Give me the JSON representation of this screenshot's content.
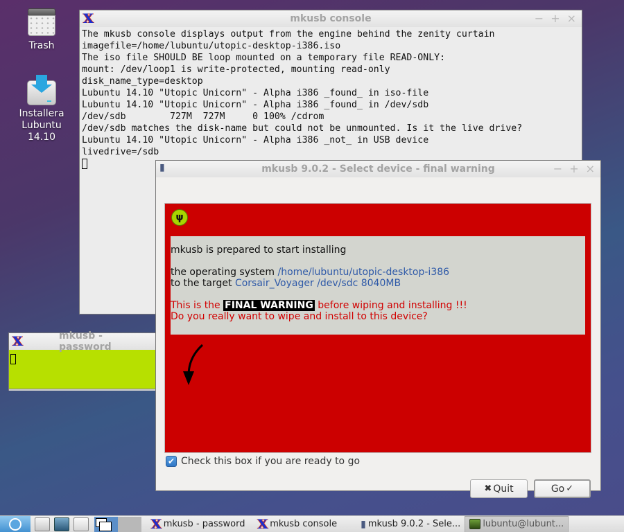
{
  "desktop": {
    "icons": [
      {
        "label": "Trash",
        "icon": "trash-icon"
      },
      {
        "label": "Installera\nLubuntu 14.10",
        "label_line1": "Installera",
        "label_line2": "Lubuntu 14.10",
        "icon": "install-drive-icon"
      }
    ],
    "background_colors": [
      "#5a2f6a",
      "#3a5886",
      "#4a4c8a"
    ]
  },
  "console": {
    "title": "mkusb console",
    "icon": "xterm-icon",
    "wm_buttons": {
      "minimize": "−",
      "maximize": "+",
      "close": "×"
    },
    "lines": [
      "The mkusb console displays output from the engine behind the zenity curtain",
      "imagefile=/home/lubuntu/utopic-desktop-i386.iso",
      "The iso file SHOULD BE loop mounted on a temporary file READ-ONLY:",
      "mount: /dev/loop1 is write-protected, mounting read-only",
      "disk_name_type=desktop",
      "Lubuntu 14.10 \"Utopic Unicorn\" - Alpha i386 _found_ in iso-file",
      "Lubuntu 14.10 \"Utopic Unicorn\" - Alpha i386 _found_ in /dev/sdb",
      "/dev/sdb        727M  727M     0 100% /cdrom",
      "/dev/sdb matches the disk-name but could not be unmounted. Is it the live drive?",
      "Lubuntu 14.10 \"Utopic Unicorn\" - Alpha i386 _not_ in USB device",
      "livedrive=/sdb"
    ]
  },
  "password_window": {
    "title": "mkusb - password",
    "icon": "xterm-icon",
    "background": "#b7e000"
  },
  "dialog": {
    "title": "mkusb 9.0.2 - Select device - final warning",
    "icon": "usb-drive-icon",
    "wm_buttons": {
      "minimize": "−",
      "maximize": "+",
      "close": "×"
    },
    "badge_icon": "usb-symbol-icon",
    "badge_glyph": "ψ",
    "message": {
      "line1": "mkusb is prepared to start installing",
      "os_prefix": "the operating system ",
      "os_value": "/home/lubuntu/utopic-desktop-i386",
      "target_prefix": "to the target ",
      "target_value": "Corsair_Voyager /dev/sdc 8040MB",
      "warn_prefix": "This is the ",
      "warn_highlight": "FINAL WARNING",
      "warn_suffix": " before wiping and installing !!!",
      "question": "Do you really want to wipe and install to this device?"
    },
    "checkbox": {
      "label": "Check this box if you are ready to go",
      "checked": true
    },
    "buttons": {
      "quit": {
        "label": "Quit",
        "icon": "✖"
      },
      "go": {
        "label": "Go",
        "icon": "✓"
      }
    },
    "colors": {
      "warning_bg": "#cc0000",
      "message_bg": "#d3d5cf",
      "link_blue": "#2f5aa8",
      "warning_red": "#d10000"
    }
  },
  "taskbar": {
    "tasks": [
      {
        "label": "mkusb - password",
        "icon": "xterm-icon"
      },
      {
        "label": "mkusb console",
        "icon": "xterm-icon"
      },
      {
        "label": "mkusb 9.0.2 - Sele...",
        "icon": "usb-drive-icon"
      },
      {
        "label": "lubuntu@lubunt...",
        "icon": "terminal-icon",
        "active": true
      }
    ]
  }
}
